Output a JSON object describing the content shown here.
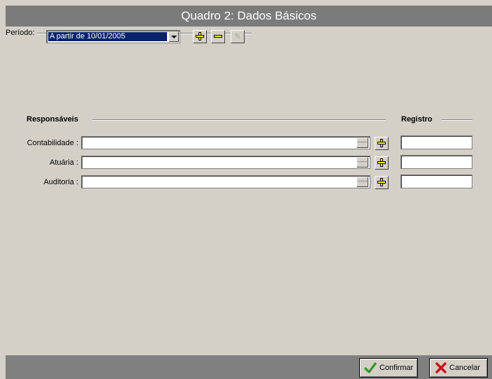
{
  "window": {
    "title": "Quadro 2: Dados Básicos"
  },
  "periodo": {
    "label": "Período:",
    "selected": "A partir de 10/01/2005",
    "buttons": [
      "plus-icon",
      "minus-icon",
      "pencil-icon"
    ]
  },
  "sections": {
    "responsaveis": "Responsáveis",
    "registro": "Registro"
  },
  "rows": [
    {
      "label": "Contabilidade :",
      "value": "",
      "registro": ""
    },
    {
      "label": "Atuária :",
      "value": "",
      "registro": ""
    },
    {
      "label": "Auditoria :",
      "value": "",
      "registro": ""
    }
  ],
  "ellipsis": "......",
  "footer": {
    "confirm_label": "Confirmar",
    "cancel_label": "Cancelar"
  },
  "colors": {
    "titlebar": "#7b7b7b",
    "selection": "#0a246a",
    "plus_yellow": "#ffff00",
    "confirm_green": "#2c9a1e",
    "cancel_red": "#cc1010"
  }
}
